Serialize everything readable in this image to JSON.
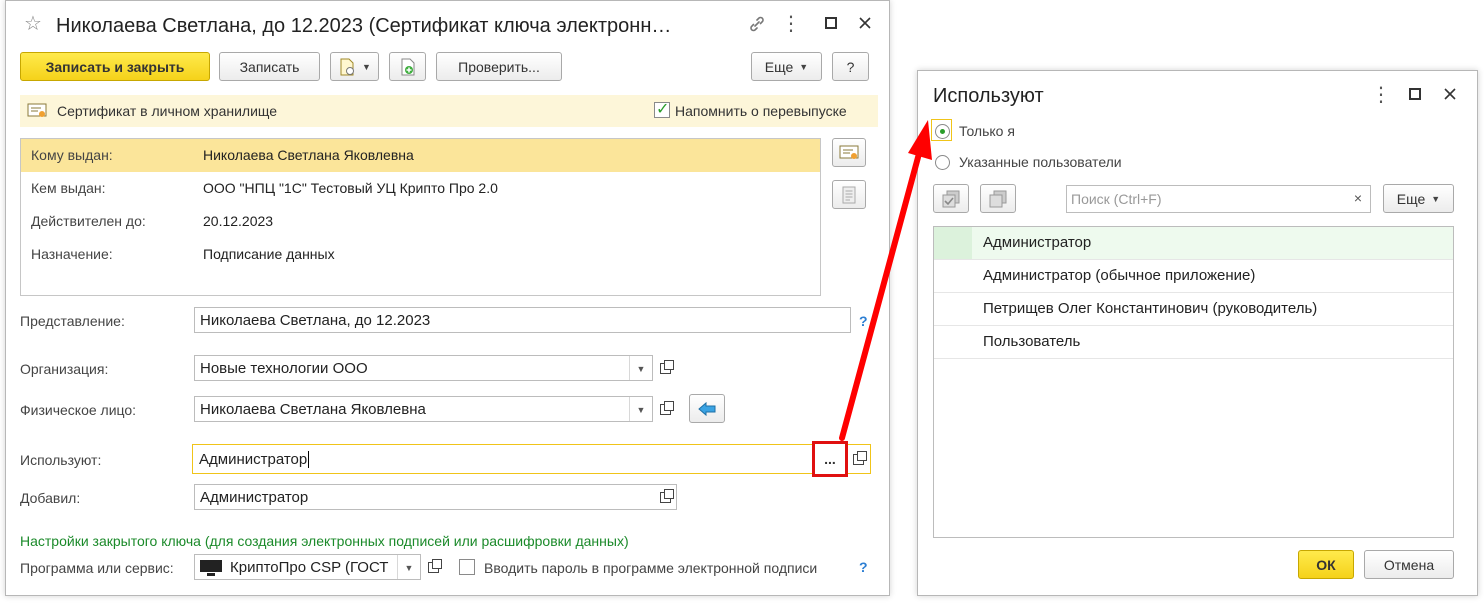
{
  "main": {
    "title": "Николаева Светлана, до 12.2023 (Сертификат ключа электронн…",
    "toolbar": {
      "save_close": "Записать и закрыть",
      "save": "Записать",
      "check": "Проверить...",
      "more": "Еще",
      "help": "?"
    },
    "banner": {
      "text": "Сертификат в личном хранилище",
      "remind_label": "Напомнить о перевыпуске",
      "remind_checked": true
    },
    "info": [
      {
        "key": "Кому выдан:",
        "value": "Николаева Светлана Яковлевна"
      },
      {
        "key": "Кем выдан:",
        "value": "ООО \"НПЦ \"1С\" Тестовый УЦ Крипто Про 2.0"
      },
      {
        "key": "Действителен до:",
        "value": "20.12.2023"
      },
      {
        "key": "Назначение:",
        "value": "Подписание данных"
      }
    ],
    "fields": {
      "representation_label": "Представление:",
      "representation_value": "Николаева Светлана, до 12.2023",
      "organization_label": "Организация:",
      "organization_value": "Новые технологии ООО",
      "person_label": "Физическое лицо:",
      "person_value": "Николаева Светлана Яковлевна",
      "users_label": "Используют:",
      "users_value": "Администратор",
      "users_select": "...",
      "added_label": "Добавил:",
      "added_value": "Администратор"
    },
    "help_mark": "?",
    "private_key_header": "Настройки закрытого ключа (для создания электронных подписей или расшифровки данных)",
    "program_label": "Программа или сервис:",
    "program_value": "КриптоПро CSP (ГОСТ",
    "enter_password_label": "Вводить пароль в программе электронной подписи",
    "enter_password_checked": false
  },
  "dialog": {
    "title": "Используют",
    "radio_only_me": "Только я",
    "radio_only_me_selected": true,
    "radio_specified": "Указанные пользователи",
    "search_placeholder": "Поиск (Ctrl+F)",
    "search_clear": "×",
    "more": "Еще",
    "rows": [
      "Администратор",
      "Администратор (обычное приложение)",
      "Петрищев Олег Константинович (руководитель)",
      "Пользователь"
    ],
    "ok": "ОК",
    "cancel": "Отмена"
  },
  "colors": {
    "primary_button": "#f5d21a",
    "selected_row": "#fbe59a",
    "banner": "#fdf6d9",
    "arrow": "#ff0000",
    "section_header": "#1b8a2a",
    "help": "#2d7fd3"
  }
}
